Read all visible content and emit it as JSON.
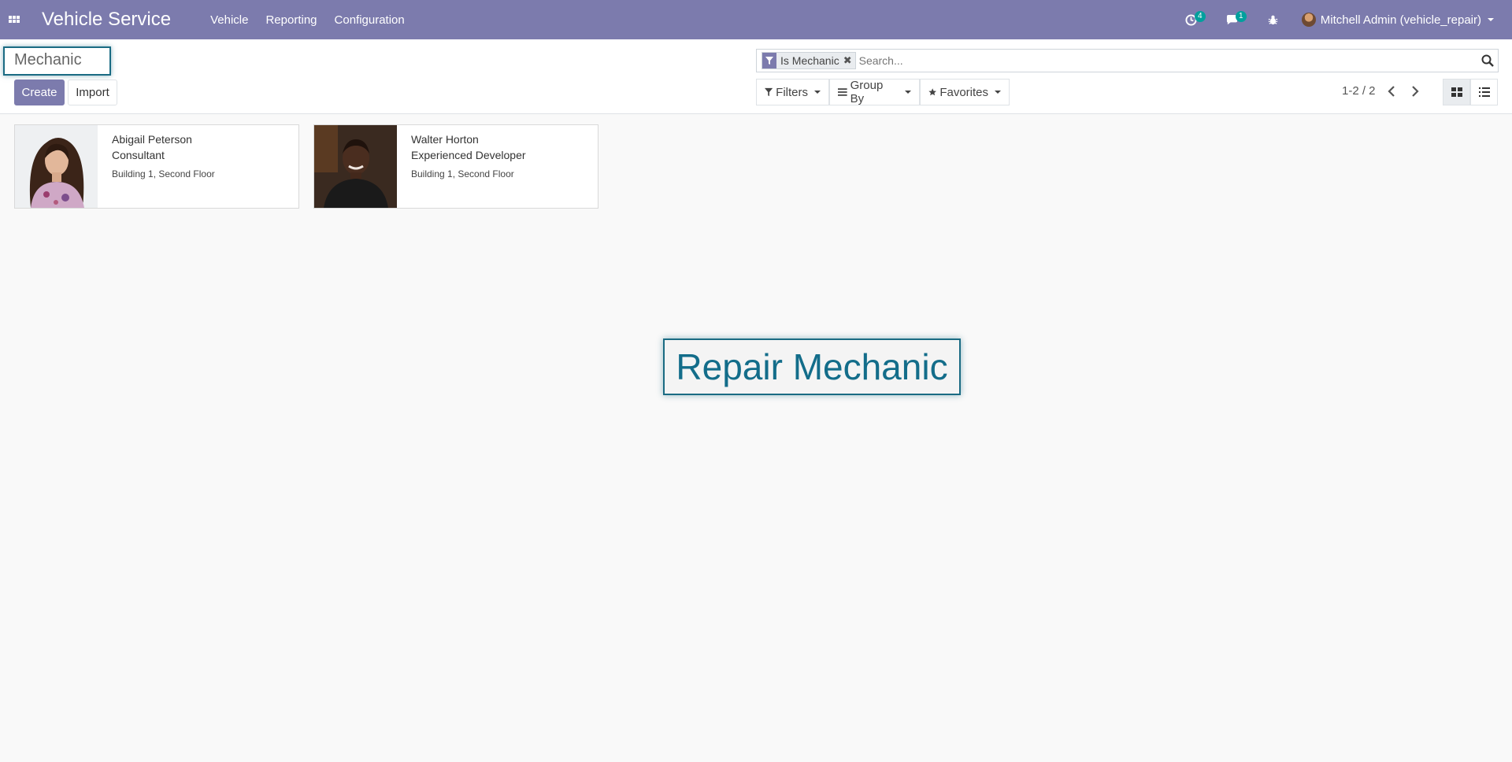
{
  "navbar": {
    "app_title": "Vehicle Service",
    "menu": [
      "Vehicle",
      "Reporting",
      "Configuration"
    ],
    "activity_count": "4",
    "message_count": "1",
    "user_label": "Mitchell Admin (vehicle_repair)"
  },
  "control_panel": {
    "breadcrumb": "Mechanic",
    "create_label": "Create",
    "import_label": "Import",
    "search": {
      "facet": "Is Mechanic",
      "facet_remove": "✖",
      "placeholder": "Search..."
    },
    "filters_label": "Filters",
    "groupby_label": "Group By",
    "favorites_label": "Favorites",
    "pager": "1-2 / 2"
  },
  "cards": [
    {
      "name": "Abigail Peterson",
      "job": "Consultant",
      "location": "Building 1, Second Floor"
    },
    {
      "name": "Walter Horton",
      "job": "Experienced Developer",
      "location": "Building 1, Second Floor"
    }
  ],
  "overlay_label": "Repair Mechanic",
  "colors": {
    "navbar": "#7c7bad",
    "accent": "#7c7bad",
    "badge": "#00a09d",
    "overlay_text": "#136d8a"
  }
}
